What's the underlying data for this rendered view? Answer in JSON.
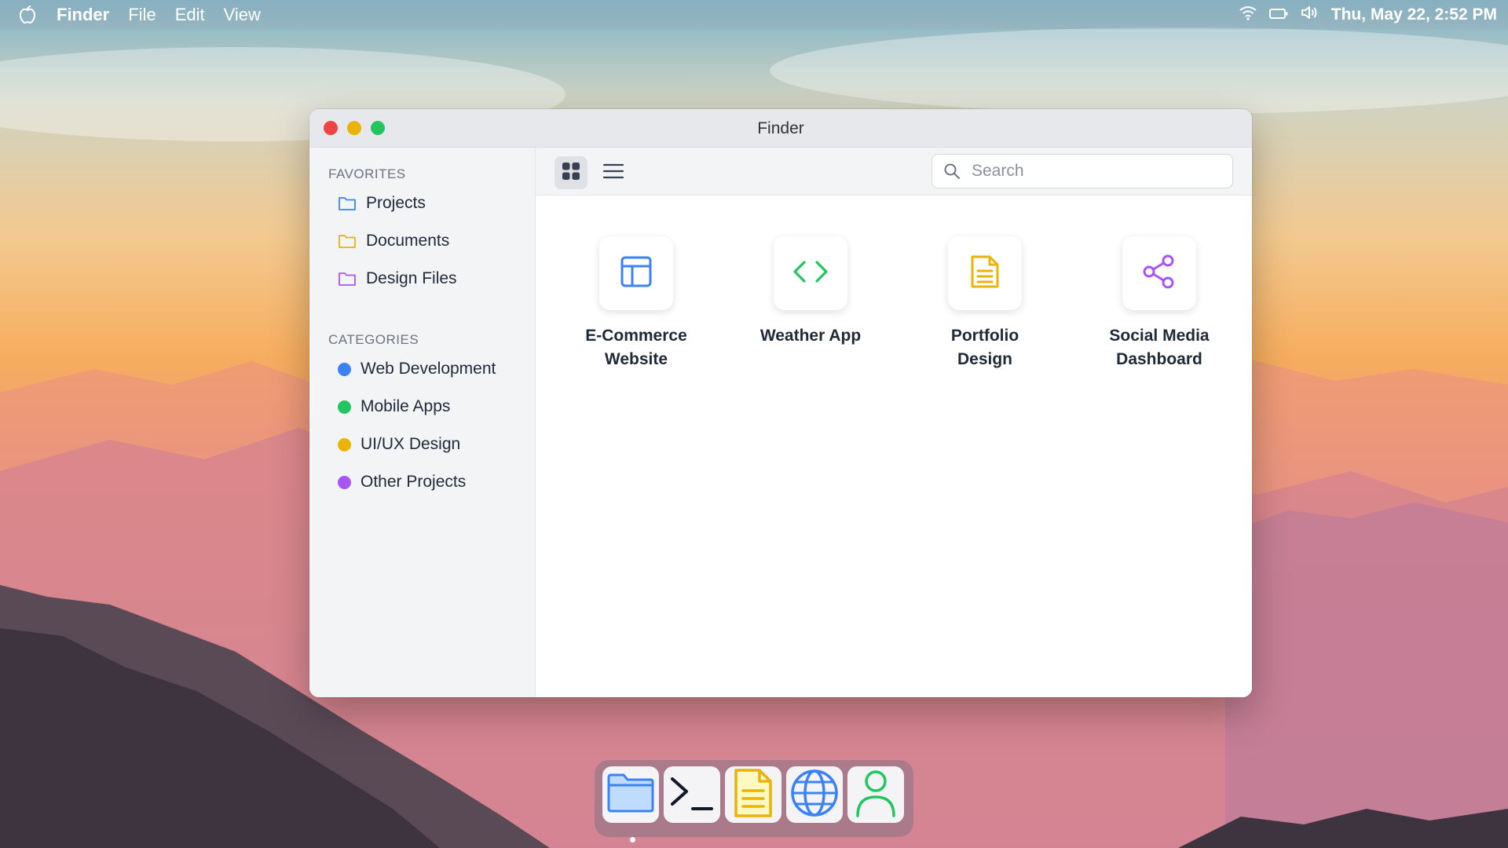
{
  "menubar": {
    "app_name": "Finder",
    "menus": [
      "File",
      "Edit",
      "View"
    ],
    "clock": "Thu, May 22, 2:52 PM"
  },
  "window": {
    "title": "Finder",
    "sidebar": {
      "favorites_title": "FAVORITES",
      "favorites": [
        {
          "label": "Projects",
          "icon": "folder-icon",
          "color": "#3b82f6"
        },
        {
          "label": "Documents",
          "icon": "folder-icon",
          "color": "#eab308"
        },
        {
          "label": "Design Files",
          "icon": "folder-icon",
          "color": "#a855f7"
        }
      ],
      "categories_title": "CATEGORIES",
      "categories": [
        {
          "label": "Web Development",
          "color": "#3b82f6"
        },
        {
          "label": "Mobile Apps",
          "color": "#22c55e"
        },
        {
          "label": "UI/UX Design",
          "color": "#eab308"
        },
        {
          "label": "Other Projects",
          "color": "#a855f7"
        }
      ]
    },
    "toolbar": {
      "search_placeholder": "Search",
      "view_mode": "grid"
    },
    "files": [
      {
        "line1": "E-Commerce",
        "line2": "Website",
        "icon": "layout-icon",
        "color": "#3b82f6"
      },
      {
        "line1": "Weather App",
        "line2": "",
        "icon": "code-icon",
        "color": "#22c55e"
      },
      {
        "line1": "Portfolio",
        "line2": "Design",
        "icon": "document-icon",
        "color": "#eab308"
      },
      {
        "line1": "Social Media",
        "line2": "Dashboard",
        "icon": "share-icon",
        "color": "#a855f7"
      }
    ]
  },
  "dock": {
    "apps": [
      {
        "name": "Finder",
        "icon": "folder-icon",
        "color": "#3b82f6",
        "running": true
      },
      {
        "name": "Terminal",
        "icon": "terminal-icon",
        "color": "#111827",
        "running": false
      },
      {
        "name": "Notes",
        "icon": "notes-icon",
        "color": "#eab308",
        "running": false
      },
      {
        "name": "Browser",
        "icon": "globe-icon",
        "color": "#3b82f6",
        "running": false
      },
      {
        "name": "Contacts",
        "icon": "user-icon",
        "color": "#22c55e",
        "running": false
      }
    ]
  }
}
